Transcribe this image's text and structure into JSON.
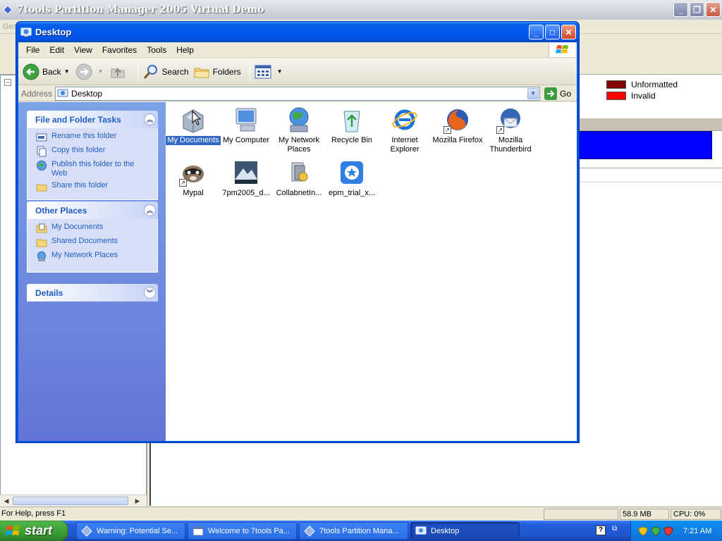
{
  "background_app": {
    "title": "7tools Partition Manager 2005 Virtual Demo",
    "menu_partial": "Gen",
    "legend": [
      {
        "label": "Unformatted",
        "color": "#800000"
      },
      {
        "label": "Invalid",
        "color": "#ff0000"
      }
    ],
    "status": {
      "help_text": "For Help, press F1",
      "memory": "58.9 MB",
      "cpu": "CPU: 0%"
    }
  },
  "explorer": {
    "title": "Desktop",
    "menu": [
      "File",
      "Edit",
      "View",
      "Favorites",
      "Tools",
      "Help"
    ],
    "toolbar": {
      "back": "Back",
      "search": "Search",
      "folders": "Folders"
    },
    "address": {
      "label": "Address",
      "value": "Desktop",
      "go": "Go"
    },
    "task_pane": {
      "file_folder_tasks": {
        "title": "File and Folder Tasks",
        "items": [
          "Rename this folder",
          "Copy this folder",
          "Publish this folder to the Web",
          "Share this folder"
        ]
      },
      "other_places": {
        "title": "Other Places",
        "items": [
          "My Documents",
          "Shared Documents",
          "My Network Places"
        ]
      },
      "details": {
        "title": "Details"
      }
    },
    "icons": [
      {
        "label": "My Documents",
        "icon": "my-documents-icon",
        "selected": true
      },
      {
        "label": "My Computer",
        "icon": "my-computer-icon"
      },
      {
        "label": "My Network Places",
        "icon": "network-places-icon"
      },
      {
        "label": "Recycle Bin",
        "icon": "recycle-bin-icon"
      },
      {
        "label": "Internet Explorer",
        "icon": "internet-explorer-icon"
      },
      {
        "label": "Mozilla Firefox",
        "icon": "firefox-icon"
      },
      {
        "label": "Mozilla Thunderbird",
        "icon": "thunderbird-icon"
      },
      {
        "label": "Mypal",
        "icon": "mypal-icon"
      },
      {
        "label": "7pm2005_d...",
        "icon": "7pm2005-icon"
      },
      {
        "label": "CollabnetIn...",
        "icon": "collabnet-icon"
      },
      {
        "label": "epm_trial_x...",
        "icon": "epm-trial-icon"
      }
    ]
  },
  "taskbar": {
    "start": "start",
    "tasks": [
      "Warning: Potential Se...",
      "Welcome to 7tools Pa...",
      "7tools Partition Mana...",
      "Desktop"
    ],
    "clock": "7:21 AM"
  }
}
